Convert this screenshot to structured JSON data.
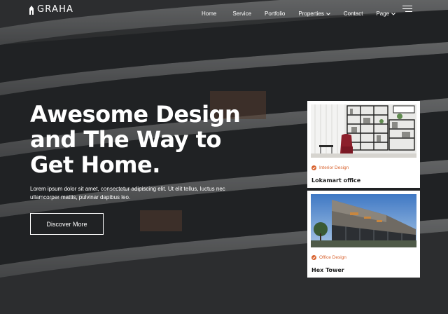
{
  "brand": {
    "name": "GRAHA",
    "logo_icon": "building-logo-icon"
  },
  "nav": {
    "items": [
      {
        "label": "Home",
        "has_dropdown": false
      },
      {
        "label": "Service",
        "has_dropdown": false
      },
      {
        "label": "Portfolio",
        "has_dropdown": false
      },
      {
        "label": "Properties",
        "has_dropdown": true
      },
      {
        "label": "Contact",
        "has_dropdown": false
      },
      {
        "label": "Page",
        "has_dropdown": true
      }
    ],
    "menu_icon": "hamburger-menu-icon"
  },
  "hero": {
    "headline_lines": [
      "Awesome Design",
      "and The Way to",
      "Get Home."
    ],
    "description": "Lorem ipsum dolor sit amet, consectetur adipiscing elit. Ut elit tellus, luctus nec ullamcorper mattis, pulvinar dapibus leo.",
    "cta_label": "Discover More"
  },
  "cards": [
    {
      "category": "Interior Design",
      "title": "Lokamart office",
      "image": "interior-living-room-image"
    },
    {
      "category": "Office Design",
      "title": "Hex Tower",
      "image": "modern-building-exterior-image"
    }
  ],
  "colors": {
    "accent": "#d8622e",
    "text_on_dark": "#ffffff",
    "card_bg": "#ffffff",
    "title_text": "#1e1e1e"
  }
}
